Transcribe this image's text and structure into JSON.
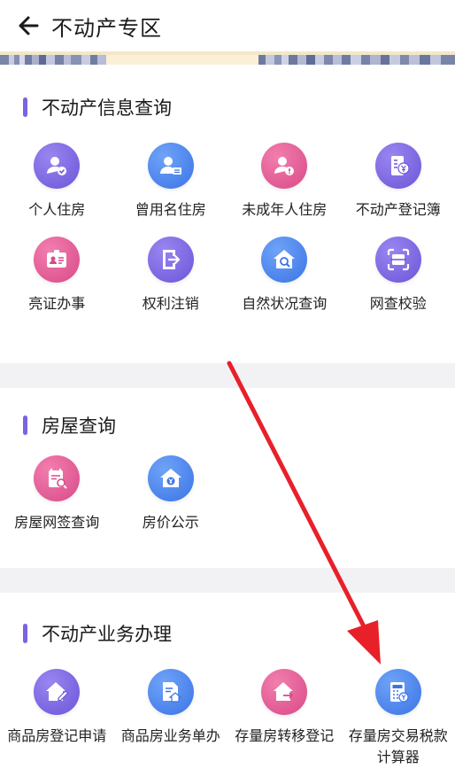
{
  "header": {
    "title": "不动产专区"
  },
  "sections": [
    {
      "title": "不动产信息查询",
      "items": [
        {
          "label": "个人住房",
          "icon": "person-check-icon",
          "color": "purple"
        },
        {
          "label": "曾用名住房",
          "icon": "person-card-icon",
          "color": "blue"
        },
        {
          "label": "未成年人住房",
          "icon": "person-alert-icon",
          "color": "pink"
        },
        {
          "label": "不动产登记簿",
          "icon": "ledger-yen-icon",
          "color": "purple"
        },
        {
          "label": "亮证办事",
          "icon": "id-card-icon",
          "color": "pink"
        },
        {
          "label": "权利注销",
          "icon": "door-exit-icon",
          "color": "purple"
        },
        {
          "label": "自然状况查询",
          "icon": "house-search-icon",
          "color": "blue"
        },
        {
          "label": "网查校验",
          "icon": "scan-icon",
          "color": "purple"
        }
      ]
    },
    {
      "title": "房屋查询",
      "items": [
        {
          "label": "房屋网签查询",
          "icon": "contract-search-icon",
          "color": "pink"
        },
        {
          "label": "房价公示",
          "icon": "house-price-icon",
          "color": "blue"
        }
      ]
    },
    {
      "title": "不动产业务办理",
      "items": [
        {
          "label": "商品房登记申请",
          "icon": "house-edit-icon",
          "color": "purple"
        },
        {
          "label": "商品房业务单办",
          "icon": "document-house-icon",
          "color": "blue"
        },
        {
          "label": "存量房转移登记",
          "icon": "house-transfer-icon",
          "color": "pink"
        },
        {
          "label": "存量房交易税款计算器",
          "icon": "calculator-icon",
          "color": "blue"
        }
      ]
    }
  ],
  "colors": {
    "accent_bar": "#7c63e0",
    "arrow": "#e8202a"
  }
}
